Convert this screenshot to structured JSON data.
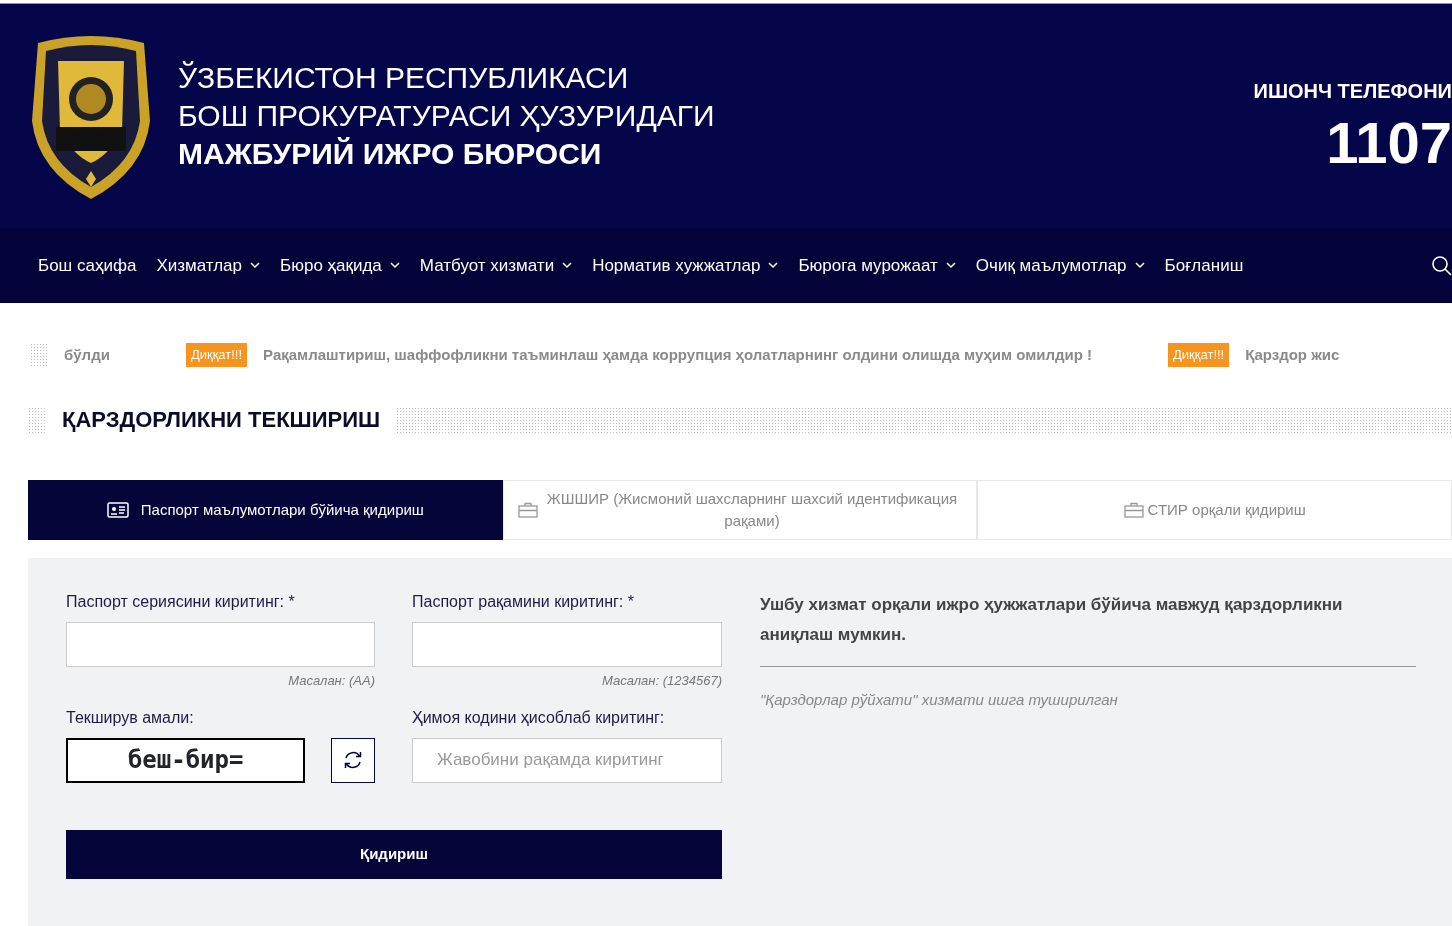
{
  "header": {
    "title_lines": [
      "ЎЗБЕКИСТОН РЕСПУБЛИКАСИ",
      "БОШ ПРОКУРАТУРАСИ ҲУЗУРИДАГИ",
      "МАЖБУРИЙ ИЖРО БЮРОСИ"
    ],
    "hotline_label": "ИШОНЧ ТЕЛЕФОНИ",
    "hotline_number": "1107"
  },
  "nav": {
    "items": [
      {
        "label": "Бош саҳифа",
        "dropdown": false
      },
      {
        "label": "Хизматлар",
        "dropdown": true
      },
      {
        "label": "Бюро ҳақида",
        "dropdown": true
      },
      {
        "label": "Матбуот хизмати",
        "dropdown": true
      },
      {
        "label": "Норматив хужжатлар",
        "dropdown": true
      },
      {
        "label": "Бюрога мурожаат",
        "dropdown": true
      },
      {
        "label": "Очиқ маълумотлар",
        "dropdown": true
      },
      {
        "label": "Боғланиш",
        "dropdown": false
      }
    ]
  },
  "ticker": [
    {
      "text": "бўлди"
    },
    {
      "badge": "Диққат!!!",
      "text": "Рақамлаштириш, шаффофликни таъминлаш ҳамда коррупция ҳолатларнинг олдини олишда муҳим омилдир !"
    },
    {
      "badge": "Диққат!!!",
      "text": "Қарздор жис"
    }
  ],
  "section_title": "ҚАРЗДОРЛИКНИ ТЕКШИРИШ",
  "tabs": [
    {
      "label": "Паспорт маълумотлари бўйича қидириш",
      "selected": true
    },
    {
      "label": "ЖШШИР (Жисмоний шахсларнинг шахсий идентификация рақами)",
      "selected": false
    },
    {
      "label": "СТИР орқали қидириш",
      "selected": false
    }
  ],
  "form": {
    "series": {
      "label": "Паспорт сериясини киритинг: *",
      "hint": "Масалан: (AA)"
    },
    "number": {
      "label": "Паспорт рақамини киритинг: *",
      "hint": "Масалан: (1234567)"
    },
    "captcha": {
      "label": "Текширув амали:",
      "expression": "беш-бир="
    },
    "answer": {
      "label": "Ҳимоя кодини ҳисоблаб киритинг:",
      "placeholder": "Жавобини рақамда киритинг"
    },
    "submit": "Қидириш"
  },
  "info": {
    "text": "Ушбу хизмат орқали ижро ҳужжатлари бўйича мавжуд қарздорликни аниқлаш мумкин.",
    "note": "\"Қарздорлар рўйхати\" хизмати ишга туширилган"
  }
}
